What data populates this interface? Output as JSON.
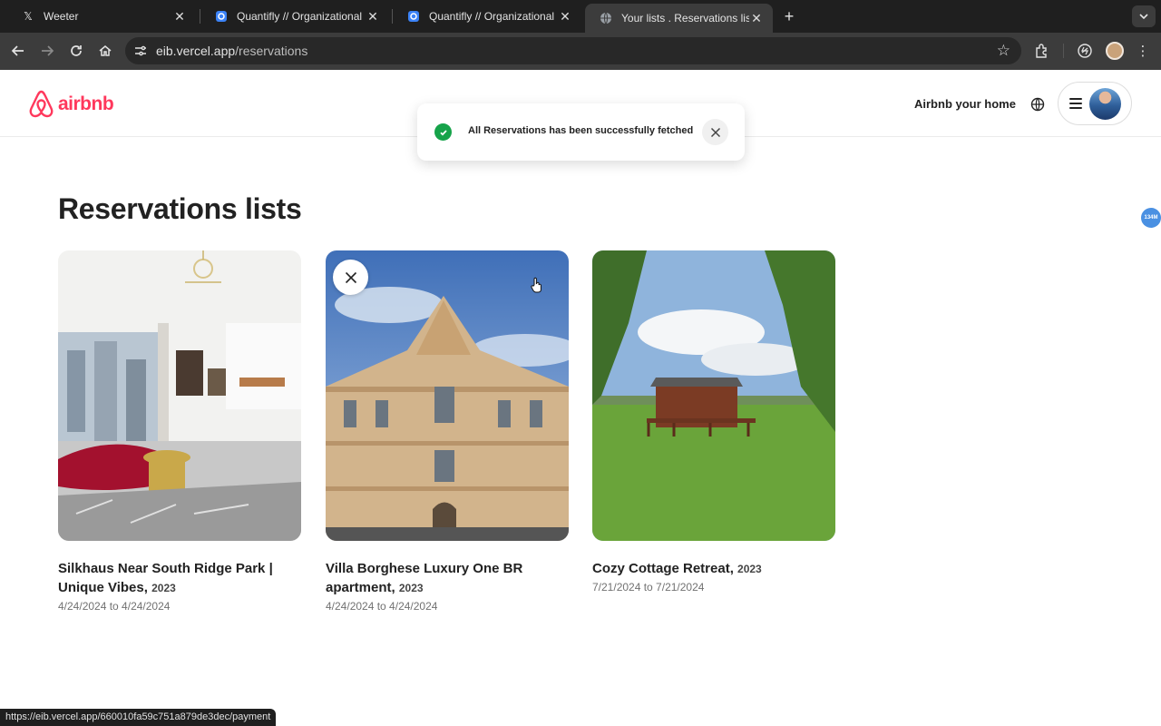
{
  "browser": {
    "tabs": [
      {
        "title": "Weeter",
        "favicon": "x-logo-icon"
      },
      {
        "title": "Quantifly // Organizational Di",
        "favicon": "quantifly-icon"
      },
      {
        "title": "Quantifly // Organizational Di",
        "favicon": "quantifly-icon"
      },
      {
        "title": "Your lists . Reservations lists",
        "favicon": "globe-icon"
      }
    ],
    "url_host": "eib.vercel.app",
    "url_path": "/reservations",
    "status_url": "https://eib.vercel.app/660010fa59c751a879de3dec/payment"
  },
  "header": {
    "brand": "airbnb",
    "host_link": "Airbnb your home"
  },
  "toast": {
    "message": "All Reservations has been successfully fetched"
  },
  "page": {
    "title": "Reservations lists",
    "badge": "134M"
  },
  "reservations": [
    {
      "name": "Silkhaus Near South Ridge Park | Unique Vibes,",
      "year": "2023",
      "dates": "4/24/2024 to 4/24/2024"
    },
    {
      "name": "Villa Borghese Luxury One BR apartment,",
      "year": "2023",
      "dates": "4/24/2024 to 4/24/2024"
    },
    {
      "name": "Cozy Cottage Retreat,",
      "year": "2023",
      "dates": "7/21/2024 to 7/21/2024"
    }
  ],
  "colors": {
    "brand": "#ff385c",
    "success": "#16a34a"
  }
}
